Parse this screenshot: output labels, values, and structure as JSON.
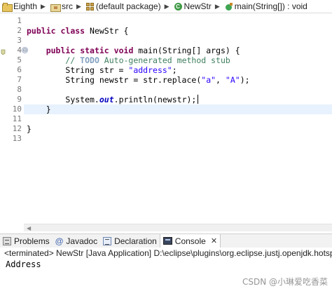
{
  "breadcrumb": {
    "items": [
      {
        "label": "Eighth",
        "icon": "project-folder-icon"
      },
      {
        "label": "src",
        "icon": "source-folder-icon"
      },
      {
        "label": "(default package)",
        "icon": "package-icon"
      },
      {
        "label": "NewStr",
        "icon": "class-icon"
      },
      {
        "label": "main(String[]) : void",
        "icon": "method-icon"
      }
    ],
    "separator": "▶"
  },
  "editor": {
    "line_numbers": [
      "1",
      "2",
      "3",
      "4",
      "5",
      "6",
      "7",
      "8",
      "9",
      "10",
      "11",
      "12",
      "13"
    ],
    "fold_marker": "⊖",
    "current_line": 9,
    "lines": [
      {
        "n": 1,
        "indent": "",
        "tokens": []
      },
      {
        "n": 2,
        "indent": "",
        "tokens": [
          {
            "t": "kw",
            "v": "public"
          },
          {
            "t": "pl",
            "v": " "
          },
          {
            "t": "kw",
            "v": "class"
          },
          {
            "t": "pl",
            "v": " NewStr {"
          }
        ]
      },
      {
        "n": 3,
        "indent": "",
        "tokens": []
      },
      {
        "n": 4,
        "indent": "    ",
        "tokens": [
          {
            "t": "kw",
            "v": "public"
          },
          {
            "t": "pl",
            "v": " "
          },
          {
            "t": "kw",
            "v": "static"
          },
          {
            "t": "pl",
            "v": " "
          },
          {
            "t": "kw",
            "v": "void"
          },
          {
            "t": "pl",
            "v": " main(String[] args) {"
          }
        ]
      },
      {
        "n": 5,
        "indent": "        ",
        "tokens": [
          {
            "t": "cm",
            "v": "// "
          },
          {
            "t": "tag",
            "v": "TODO"
          },
          {
            "t": "cm",
            "v": " Auto-generated method stub"
          }
        ]
      },
      {
        "n": 6,
        "indent": "        ",
        "tokens": [
          {
            "t": "pl",
            "v": "String str = "
          },
          {
            "t": "str",
            "v": "\"address\""
          },
          {
            "t": "pl",
            "v": ";"
          }
        ]
      },
      {
        "n": 7,
        "indent": "        ",
        "tokens": [
          {
            "t": "pl",
            "v": "String newstr = str.replace("
          },
          {
            "t": "str",
            "v": "\"a\""
          },
          {
            "t": "pl",
            "v": ", "
          },
          {
            "t": "str",
            "v": "\"A\""
          },
          {
            "t": "pl",
            "v": ");"
          }
        ]
      },
      {
        "n": 8,
        "indent": "",
        "tokens": []
      },
      {
        "n": 9,
        "indent": "        ",
        "tokens": [
          {
            "t": "pl",
            "v": "System."
          },
          {
            "t": "fld",
            "v": "out"
          },
          {
            "t": "pl",
            "v": ".println(newstr);"
          }
        ]
      },
      {
        "n": 10,
        "indent": "    ",
        "tokens": [
          {
            "t": "pl",
            "v": "}"
          }
        ]
      },
      {
        "n": 11,
        "indent": "",
        "tokens": []
      },
      {
        "n": 12,
        "indent": "",
        "tokens": [
          {
            "t": "pl",
            "v": "}"
          }
        ]
      },
      {
        "n": 13,
        "indent": "",
        "tokens": []
      }
    ],
    "colors": {
      "keyword": "#7f0055",
      "comment": "#3f7f5f",
      "todo_tag": "#7f9fbf",
      "string": "#2a00ff",
      "static_field": "#0000c0",
      "change_bar": "#a6c6e8",
      "current_line": "#e8f2fe"
    },
    "scroll_left_arrow": "◀"
  },
  "console_panel": {
    "tabs": [
      {
        "label": "Problems",
        "icon": "problems-icon",
        "active": false
      },
      {
        "label": "Javadoc",
        "icon": "javadoc-icon",
        "active": false
      },
      {
        "label": "Declaration",
        "icon": "declaration-icon",
        "active": false
      },
      {
        "label": "Console",
        "icon": "console-icon",
        "active": true
      }
    ],
    "close_glyph": "✕",
    "status": "<terminated> NewStr [Java Application] D:\\eclipse\\plugins\\org.eclipse.justj.openjdk.hotspot",
    "output": "Address"
  },
  "watermark": "CSDN @小琳爱吃香菜"
}
